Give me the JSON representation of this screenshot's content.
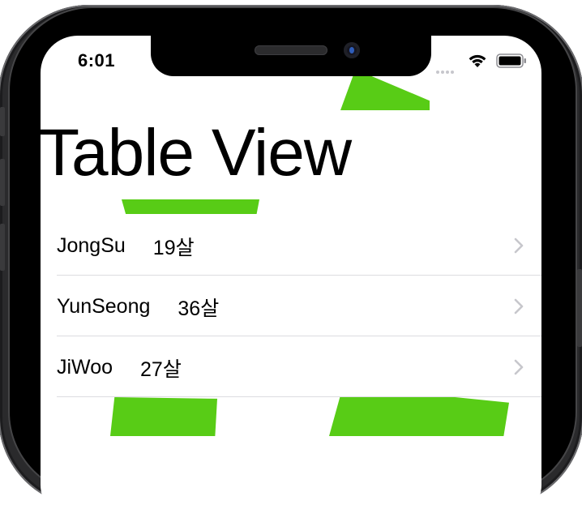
{
  "status_bar": {
    "time": "6:01",
    "signal_icon": "cellular-signal-icon",
    "wifi_icon": "wifi-icon",
    "battery_icon": "battery-icon"
  },
  "navigation": {
    "large_title": "Table View"
  },
  "table": {
    "rows": [
      {
        "name": "JongSu",
        "age": "19살"
      },
      {
        "name": "YunSeong",
        "age": "36살"
      },
      {
        "name": "JiWoo",
        "age": "27살"
      }
    ],
    "accessory_icon": "chevron-right-icon"
  },
  "colors": {
    "accent_shapes": "#58cc16",
    "chevron": "#c7c7cc",
    "separator": "#dcdce0"
  }
}
